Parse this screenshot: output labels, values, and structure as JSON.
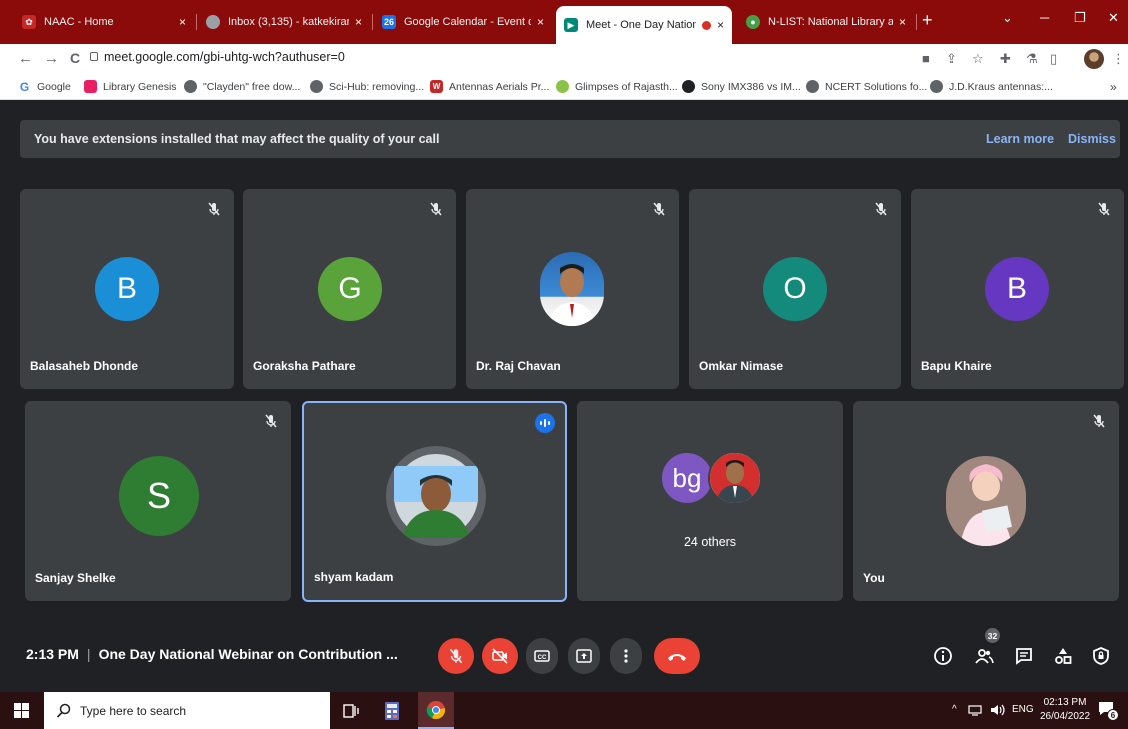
{
  "tabs": [
    {
      "title": "NAAC - Home",
      "icon": "naac-icon",
      "close": "×"
    },
    {
      "title": "Inbox (3,135) - katkekiran@g",
      "icon": "gmail-icon",
      "close": "×"
    },
    {
      "title": "Google Calendar - Event det",
      "icon": "calendar-icon",
      "badge": "26",
      "close": "×"
    },
    {
      "title": "Meet - One Day Nationa",
      "icon": "meet-icon",
      "close": "×",
      "active": true
    },
    {
      "title": "N-LIST: National Library and",
      "icon": "nlist-icon",
      "close": "×"
    }
  ],
  "browser": {
    "new_tab": "+",
    "url": "meet.google.com/gbi-uhtg-wch?authuser=0",
    "back": "←",
    "forward": "→",
    "reload": "C"
  },
  "bookmarks": [
    {
      "label": "Google",
      "icon": "google-icon",
      "glyph": "G"
    },
    {
      "label": "Library Genesis",
      "icon": "libgen-icon"
    },
    {
      "label": "\"Clayden\" free dow...",
      "icon": "globe-icon"
    },
    {
      "label": "Sci-Hub: removing...",
      "icon": "globe-icon"
    },
    {
      "label": "Antennas Aerials Pr...",
      "icon": "antennas-icon"
    },
    {
      "label": "Glimpses of Rajasth...",
      "icon": "rajasthan-icon"
    },
    {
      "label": "Sony IMX386 vs IM...",
      "icon": "apple-icon"
    },
    {
      "label": "NCERT Solutions fo...",
      "icon": "globe-icon"
    },
    {
      "label": "J.D.Kraus antennas:...",
      "icon": "globe-icon"
    }
  ],
  "bookmarks_more": "»",
  "banner": {
    "text": "You have extensions installed that may affect the quality of your call",
    "learn_more": "Learn more",
    "dismiss": "Dismiss"
  },
  "participants": [
    {
      "name": "Balasaheb Dhonde",
      "initial": "B",
      "color": "#1a8fd6",
      "muted": true
    },
    {
      "name": "Goraksha Pathare",
      "initial": "G",
      "color": "#5aa33b",
      "muted": true
    },
    {
      "name": "Dr. Raj Chavan",
      "initial": "",
      "muted": true
    },
    {
      "name": "Omkar Nimase",
      "initial": "O",
      "color": "#138a7c",
      "muted": true
    },
    {
      "name": "Bapu Khaire",
      "initial": "B",
      "color": "#6637c1",
      "muted": true
    },
    {
      "name": "Sanjay Shelke",
      "initial": "S",
      "color": "#2e7d32",
      "muted": true
    },
    {
      "name": "shyam kadam",
      "initial": "",
      "muted": false,
      "speaking": true
    },
    {
      "name": "",
      "others_label": "24 others",
      "initial": "bg",
      "color": "#7e57c2"
    },
    {
      "name": "You",
      "initial": "",
      "muted": true
    }
  ],
  "controls": {
    "time": "2:13 PM",
    "separator": "|",
    "meeting_title": "One Day National Webinar on Contribution ...",
    "people_count": "32"
  },
  "taskbar": {
    "search_placeholder": "Type here to search",
    "language": "ENG",
    "time": "02:13 PM",
    "date": "26/04/2022",
    "notifications": "6",
    "tray_caret": "^"
  }
}
